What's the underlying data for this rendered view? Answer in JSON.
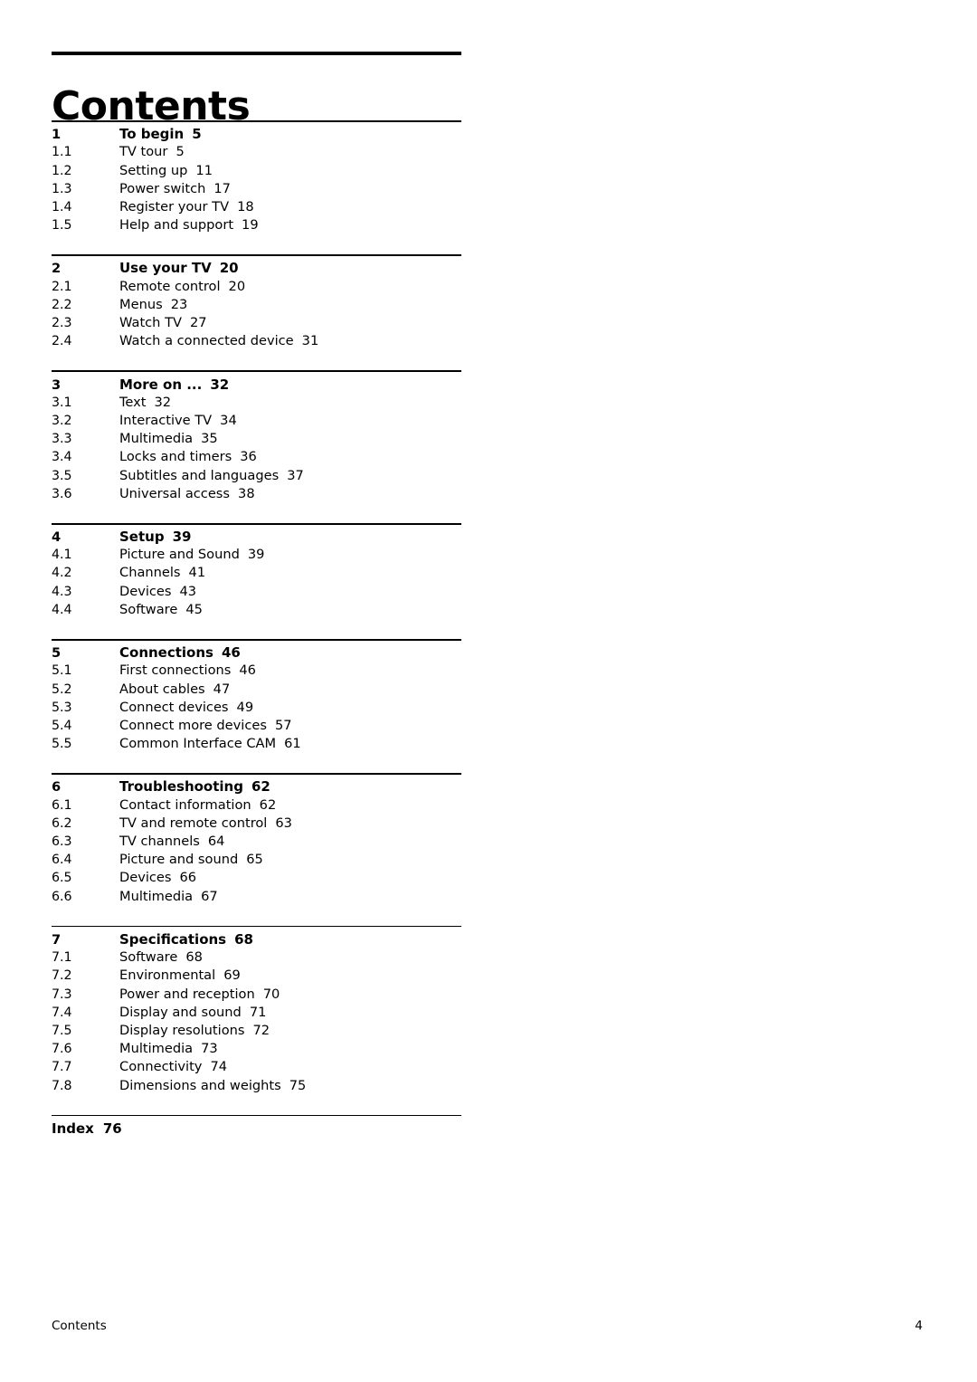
{
  "document": {
    "title": "Contents",
    "footer_left": "Contents",
    "footer_right": "4"
  },
  "chapters": [
    {
      "number": "1",
      "title": "To begin",
      "page": "5",
      "entries": [
        {
          "number": "1.1",
          "title": "TV tour",
          "page": "5"
        },
        {
          "number": "1.2",
          "title": "Setting up",
          "page": "11"
        },
        {
          "number": "1.3",
          "title": "Power switch",
          "page": "17"
        },
        {
          "number": "1.4",
          "title": "Register your TV",
          "page": "18"
        },
        {
          "number": "1.5",
          "title": "Help and support",
          "page": "19"
        }
      ]
    },
    {
      "number": "2",
      "title": "Use your TV",
      "page": "20",
      "entries": [
        {
          "number": "2.1",
          "title": "Remote control",
          "page": "20"
        },
        {
          "number": "2.2",
          "title": "Menus",
          "page": "23"
        },
        {
          "number": "2.3",
          "title": "Watch TV",
          "page": "27"
        },
        {
          "number": "2.4",
          "title": "Watch a connected device",
          "page": "31"
        }
      ]
    },
    {
      "number": "3",
      "title": "More on ...",
      "page": "32",
      "entries": [
        {
          "number": "3.1",
          "title": "Text",
          "page": "32"
        },
        {
          "number": "3.2",
          "title": "Interactive TV",
          "page": "34"
        },
        {
          "number": "3.3",
          "title": "Multimedia",
          "page": "35"
        },
        {
          "number": "3.4",
          "title": "Locks and timers",
          "page": "36"
        },
        {
          "number": "3.5",
          "title": "Subtitles and languages",
          "page": "37"
        },
        {
          "number": "3.6",
          "title": "Universal access",
          "page": "38"
        }
      ]
    },
    {
      "number": "4",
      "title": "Setup",
      "page": "39",
      "entries": [
        {
          "number": "4.1",
          "title": "Picture and Sound",
          "page": "39"
        },
        {
          "number": "4.2",
          "title": "Channels",
          "page": "41"
        },
        {
          "number": "4.3",
          "title": "Devices",
          "page": "43"
        },
        {
          "number": "4.4",
          "title": "Software",
          "page": "45"
        }
      ]
    },
    {
      "number": "5",
      "title": "Connections",
      "page": "46",
      "entries": [
        {
          "number": "5.1",
          "title": "First connections",
          "page": "46"
        },
        {
          "number": "5.2",
          "title": "About cables",
          "page": "47"
        },
        {
          "number": "5.3",
          "title": "Connect devices",
          "page": "49"
        },
        {
          "number": "5.4",
          "title": "Connect more devices",
          "page": "57"
        },
        {
          "number": "5.5",
          "title": "Common Interface CAM",
          "page": "61"
        }
      ]
    },
    {
      "number": "6",
      "title": "Troubleshooting",
      "page": "62",
      "entries": [
        {
          "number": "6.1",
          "title": "Contact information",
          "page": "62"
        },
        {
          "number": "6.2",
          "title": "TV and remote control",
          "page": "63"
        },
        {
          "number": "6.3",
          "title": "TV channels",
          "page": "64"
        },
        {
          "number": "6.4",
          "title": "Picture and sound",
          "page": "65"
        },
        {
          "number": "6.5",
          "title": "Devices",
          "page": "66"
        },
        {
          "number": "6.6",
          "title": "Multimedia",
          "page": "67"
        }
      ]
    },
    {
      "number": "7",
      "title": "Specifications",
      "page": "68",
      "entries": [
        {
          "number": "7.1",
          "title": "Software",
          "page": "68"
        },
        {
          "number": "7.2",
          "title": "Environmental",
          "page": "69"
        },
        {
          "number": "7.3",
          "title": "Power and reception",
          "page": "70"
        },
        {
          "number": "7.4",
          "title": "Display and sound",
          "page": "71"
        },
        {
          "number": "7.5",
          "title": "Display resolutions",
          "page": "72"
        },
        {
          "number": "7.6",
          "title": "Multimedia",
          "page": "73"
        },
        {
          "number": "7.7",
          "title": "Connectivity",
          "page": "74"
        },
        {
          "number": "7.8",
          "title": "Dimensions and weights",
          "page": "75"
        }
      ]
    }
  ],
  "index": {
    "label": "Index",
    "page": "76"
  }
}
